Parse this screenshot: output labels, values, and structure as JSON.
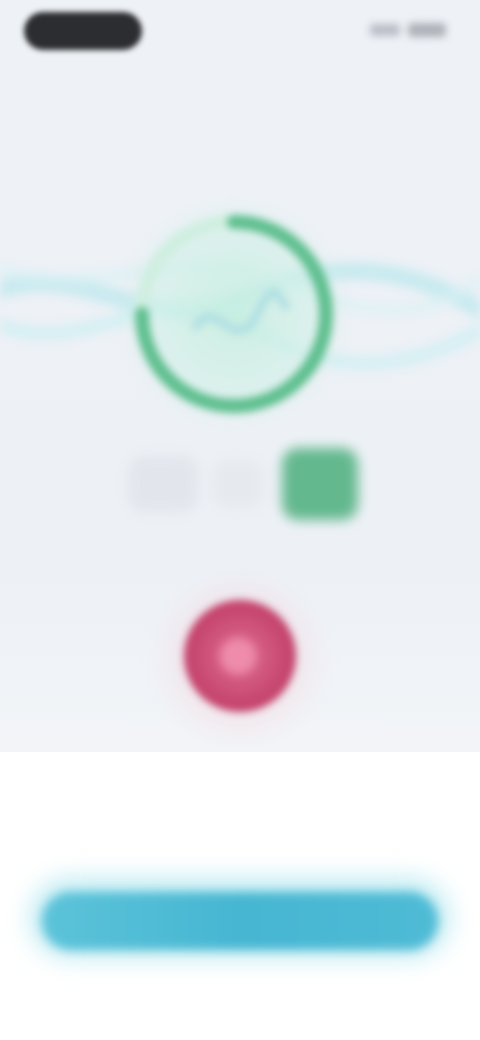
{
  "app": {
    "screen_title": ""
  },
  "status_bar": {
    "time": "",
    "signal_icon": "signal-icon",
    "battery_icon": "battery-icon"
  },
  "heading": {
    "text": ""
  },
  "progress": {
    "value": 0.75,
    "ring_color": "#5fbf8f",
    "track_color": "#cfeee0",
    "center_icon": "waveform-icon"
  },
  "mode_selector": {
    "options": [
      "",
      "",
      ""
    ],
    "selected_index": 2,
    "selected_color": "#63b88e"
  },
  "record": {
    "icon": "record-icon",
    "color": "#c8466e"
  },
  "sheet": {
    "title": "",
    "description": "",
    "cta_label": "",
    "cta_color": "#46b6d2"
  }
}
